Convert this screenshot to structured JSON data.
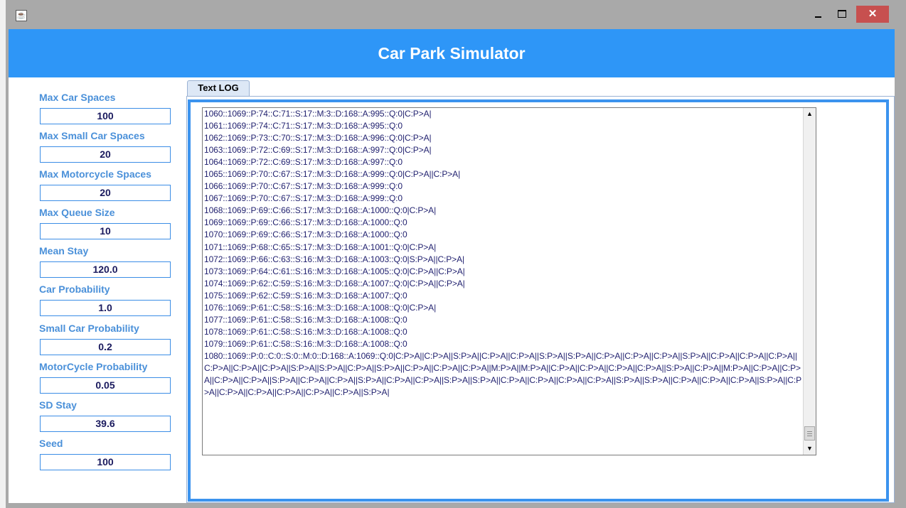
{
  "window": {
    "title": "",
    "minimize_glyph": "",
    "close_glyph": "✕"
  },
  "header": {
    "title": "Car Park Simulator"
  },
  "settings": [
    {
      "label": "Max Car Spaces",
      "value": "100"
    },
    {
      "label": "Max Small Car Spaces",
      "value": "20"
    },
    {
      "label": "Max Motorcycle Spaces",
      "value": "20"
    },
    {
      "label": "Max Queue Size",
      "value": "10"
    },
    {
      "label": "Mean Stay",
      "value": "120.0"
    },
    {
      "label": "Car Probability",
      "value": "1.0"
    },
    {
      "label": "Small Car Probability",
      "value": "0.2"
    },
    {
      "label": "MotorCycle Probability",
      "value": "0.05"
    },
    {
      "label": "SD Stay",
      "value": "39.6"
    },
    {
      "label": "Seed",
      "value": "100"
    }
  ],
  "tabs": [
    {
      "label": "Text LOG"
    }
  ],
  "log": {
    "text": "1060::1069::P:74::C:71::S:17::M:3::D:168::A:995::Q:0|C:P>A|\n1061::1069::P:74::C:71::S:17::M:3::D:168::A:995::Q:0\n1062::1069::P:73::C:70::S:17::M:3::D:168::A:996::Q:0|C:P>A|\n1063::1069::P:72::C:69::S:17::M:3::D:168::A:997::Q:0|C:P>A|\n1064::1069::P:72::C:69::S:17::M:3::D:168::A:997::Q:0\n1065::1069::P:70::C:67::S:17::M:3::D:168::A:999::Q:0|C:P>A||C:P>A|\n1066::1069::P:70::C:67::S:17::M:3::D:168::A:999::Q:0\n1067::1069::P:70::C:67::S:17::M:3::D:168::A:999::Q:0\n1068::1069::P:69::C:66::S:17::M:3::D:168::A:1000::Q:0|C:P>A|\n1069::1069::P:69::C:66::S:17::M:3::D:168::A:1000::Q:0\n1070::1069::P:69::C:66::S:17::M:3::D:168::A:1000::Q:0\n1071::1069::P:68::C:65::S:17::M:3::D:168::A:1001::Q:0|C:P>A|\n1072::1069::P:66::C:63::S:16::M:3::D:168::A:1003::Q:0|S:P>A||C:P>A|\n1073::1069::P:64::C:61::S:16::M:3::D:168::A:1005::Q:0|C:P>A||C:P>A|\n1074::1069::P:62::C:59::S:16::M:3::D:168::A:1007::Q:0|C:P>A||C:P>A|\n1075::1069::P:62::C:59::S:16::M:3::D:168::A:1007::Q:0\n1076::1069::P:61::C:58::S:16::M:3::D:168::A:1008::Q:0|C:P>A|\n1077::1069::P:61::C:58::S:16::M:3::D:168::A:1008::Q:0\n1078::1069::P:61::C:58::S:16::M:3::D:168::A:1008::Q:0\n1079::1069::P:61::C:58::S:16::M:3::D:168::A:1008::Q:0\n1080::1069::P:0::C:0::S:0::M:0::D:168::A:1069::Q:0|C:P>A||C:P>A||S:P>A||C:P>A||C:P>A||S:P>A||S:P>A||C:P>A||C:P>A||C:P>A||S:P>A||C:P>A||C:P>A||C:P>A||C:P>A||C:P>A||C:P>A||S:P>A||S:P>A||C:P>A||S:P>A||C:P>A||C:P>A||C:P>A||M:P>A||M:P>A||C:P>A||C:P>A||C:P>A||C:P>A||S:P>A||C:P>A||M:P>A||C:P>A||C:P>A||C:P>A||C:P>A||S:P>A||C:P>A||C:P>A||S:P>A||C:P>A||C:P>A||S:P>A||S:P>A||C:P>A||C:P>A||C:P>A||C:P>A||S:P>A||S:P>A||C:P>A||C:P>A||C:P>A||S:P>A||C:P>A||C:P>A||C:P>A||C:P>A||C:P>A||C:P>A||S:P>A|"
  },
  "scrollbar": {
    "up_arrow": "▲",
    "down_arrow": "▼"
  },
  "colors": {
    "header_bg": "#2e96f7",
    "label_text": "#4a90d9",
    "field_border": "#3b8de6",
    "window_chrome": "#a9a9a9",
    "close_button": "#c7504f",
    "log_text": "#1f1f6e"
  }
}
